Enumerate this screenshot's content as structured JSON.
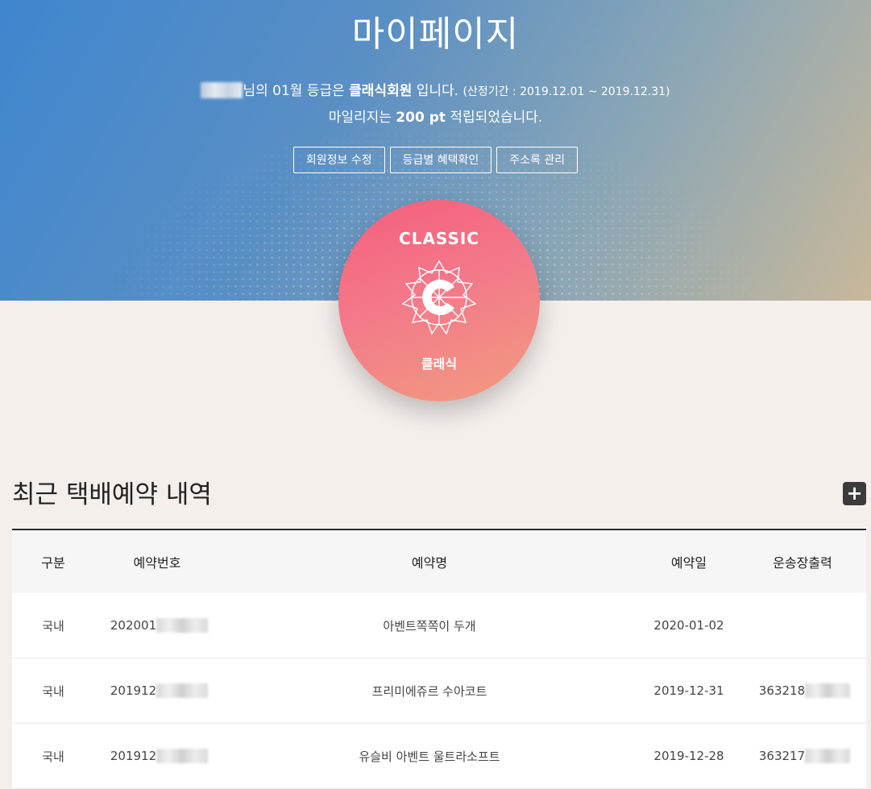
{
  "hero": {
    "title": "마이페이지",
    "line1": {
      "suffix": "님의 01월 등급은 ",
      "grade": "클래식회원",
      "after": " 입니다. ",
      "period": "(산정기간 : 2019.12.01 ~ 2019.12.31)"
    },
    "line2": {
      "prefix": "마일리지는 ",
      "points": "200 pt",
      "suffix": " 적립되었습니다."
    },
    "buttons": [
      "회원정보 수정",
      "등급별 혜택확인",
      "주소록 관리"
    ]
  },
  "badge": {
    "name_en": "CLASSIC",
    "name_ko": "클래식",
    "icon": "classic-grade-emblem-icon"
  },
  "section": {
    "title": "최근 택배예약 내역",
    "more_icon": "plus-icon",
    "more_label": "+"
  },
  "table": {
    "headers": [
      "구분",
      "예약번호",
      "예약명",
      "예약일",
      "운송장출력"
    ],
    "rows": [
      {
        "type": "국내",
        "number": "202001",
        "name": "아벤트쪽쪽이 두개",
        "date": "2020-01-02",
        "waybill": ""
      },
      {
        "type": "국내",
        "number": "201912",
        "name": "프리미에쥬르 수아코트",
        "date": "2019-12-31",
        "waybill": "363218"
      },
      {
        "type": "국내",
        "number": "201912",
        "name": "유슬비 아벤트 울트라소프트",
        "date": "2019-12-28",
        "waybill": "363217"
      }
    ]
  },
  "colors": {
    "hero_blue": "#3f86cf",
    "hero_beige": "#c8b89a",
    "badge_pink": "#f65d7b",
    "badge_peach": "#f19c80",
    "page_bg": "#f5efec"
  }
}
